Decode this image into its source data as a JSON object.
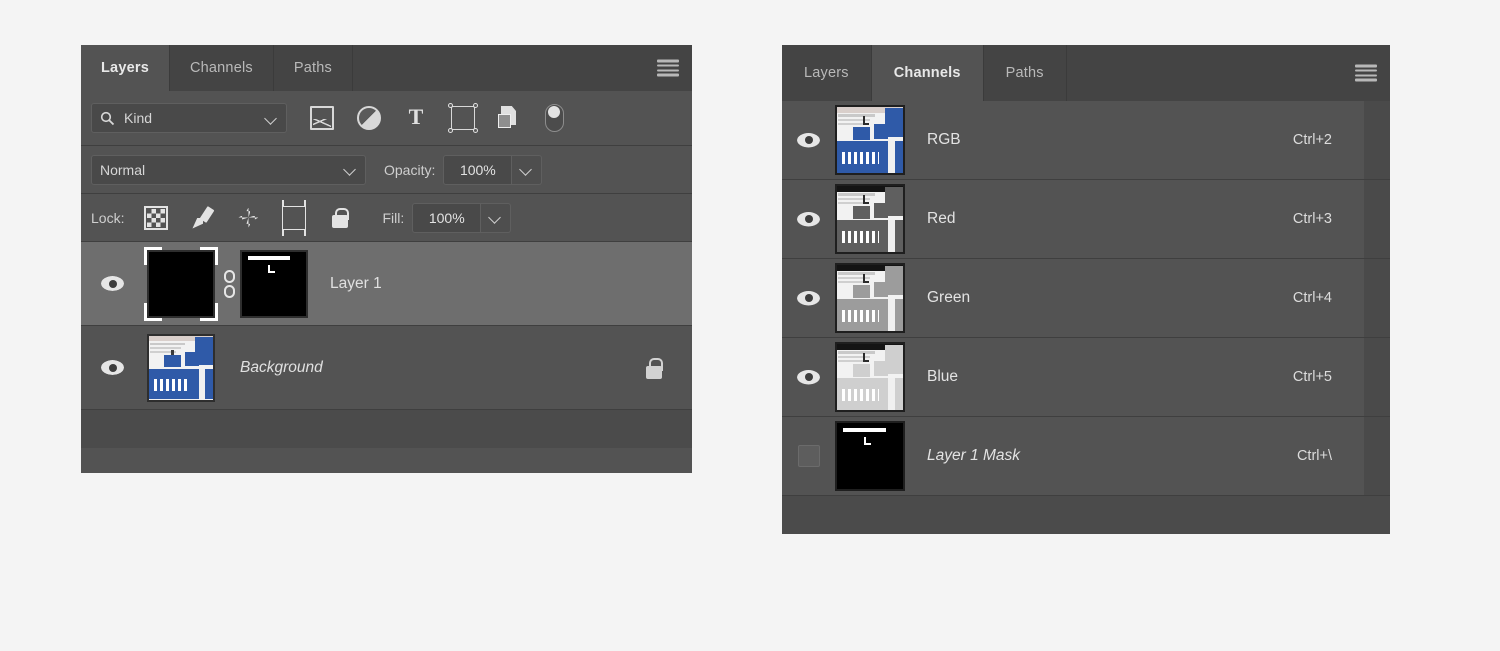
{
  "layers_panel": {
    "tabs": [
      {
        "label": "Layers",
        "active": true
      },
      {
        "label": "Channels",
        "active": false
      },
      {
        "label": "Paths",
        "active": false
      }
    ],
    "menu_icon": "hamburger-menu-icon",
    "filter": {
      "search_icon": "search-icon",
      "kind_value": "Kind",
      "dropdown_icon": "chevron-down-icon",
      "icons": [
        {
          "name": "pixel-layer-filter-icon"
        },
        {
          "name": "adjustment-layer-filter-icon"
        },
        {
          "name": "type-layer-filter-icon"
        },
        {
          "name": "shape-layer-filter-icon"
        },
        {
          "name": "smart-object-filter-icon"
        },
        {
          "name": "filter-toggle-switch-icon"
        }
      ]
    },
    "blend": {
      "mode_value": "Normal",
      "opacity_label": "Opacity:",
      "opacity_value": "100%"
    },
    "lock": {
      "label": "Lock:",
      "icons": [
        {
          "name": "lock-transparent-pixels-icon"
        },
        {
          "name": "lock-image-pixels-icon"
        },
        {
          "name": "lock-position-icon"
        },
        {
          "name": "lock-artboard-nesting-icon"
        },
        {
          "name": "lock-all-icon"
        }
      ],
      "fill_label": "Fill:",
      "fill_value": "100%"
    },
    "rows": [
      {
        "name": "Layer 1",
        "selected": true,
        "visible": true,
        "italic": false,
        "has_mask": true,
        "has_link": true,
        "locked": false,
        "thumb_type": "black"
      },
      {
        "name": "Background",
        "selected": false,
        "visible": true,
        "italic": true,
        "has_mask": false,
        "has_link": false,
        "locked": true,
        "thumb_type": "document-color"
      }
    ]
  },
  "channels_panel": {
    "tabs": [
      {
        "label": "Layers",
        "active": false
      },
      {
        "label": "Channels",
        "active": true
      },
      {
        "label": "Paths",
        "active": false
      }
    ],
    "menu_icon": "hamburger-menu-icon",
    "rows": [
      {
        "name": "RGB",
        "shortcut": "Ctrl+2",
        "visible": true,
        "italic": false,
        "thumb_type": "document-color"
      },
      {
        "name": "Red",
        "shortcut": "Ctrl+3",
        "visible": true,
        "italic": false,
        "thumb_type": "document-gray"
      },
      {
        "name": "Green",
        "shortcut": "Ctrl+4",
        "visible": true,
        "italic": false,
        "thumb_type": "document-gray-light"
      },
      {
        "name": "Blue",
        "shortcut": "Ctrl+5",
        "visible": true,
        "italic": false,
        "thumb_type": "document-gray-lighter"
      },
      {
        "name": "Layer 1 Mask",
        "shortcut": "Ctrl+\\",
        "visible": false,
        "italic": true,
        "thumb_type": "mask-black"
      }
    ]
  },
  "colors": {
    "page_background": "#f4f4f4",
    "panel_background": "#535353",
    "tabbar_background": "#444444",
    "selected_row": "#6e6e6e",
    "text": "#e0e0e0",
    "thumb_accent_blue": "#2f5aa8"
  }
}
